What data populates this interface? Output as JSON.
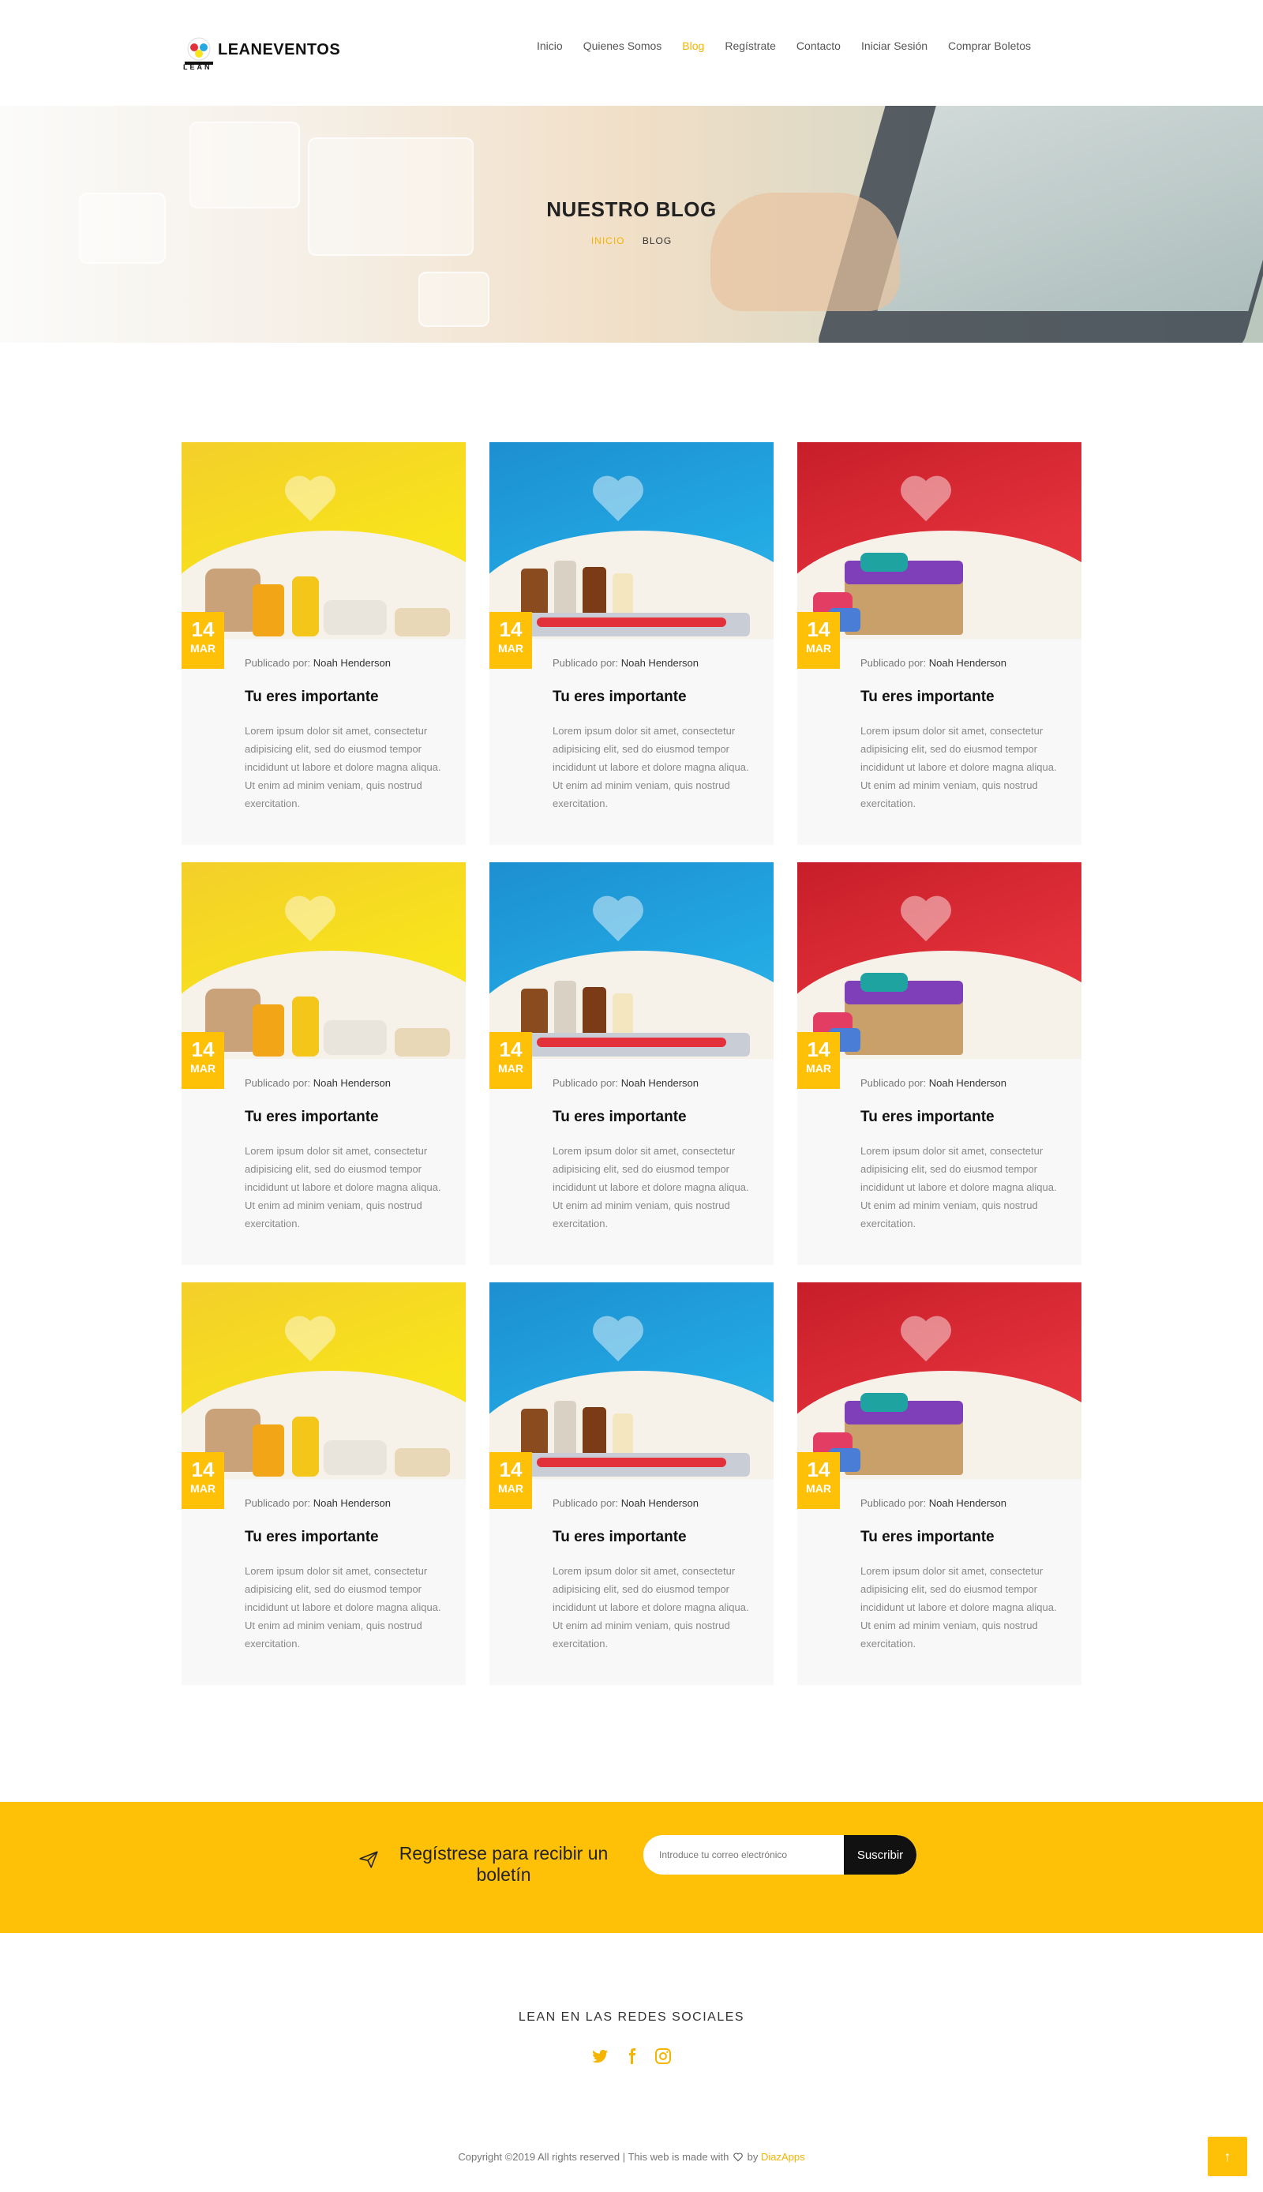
{
  "brand": {
    "name": "LEANEVENTOS",
    "sub": "LEAN"
  },
  "nav": {
    "items": [
      "Inicio",
      "Quienes Somos",
      "Blog",
      "Regístrate",
      "Contacto",
      "Iniciar Sesión",
      "Comprar Boletos"
    ],
    "active": "Blog"
  },
  "hero": {
    "title": "NUESTRO BLOG",
    "crumb_home": "INICIO",
    "crumb_current": "BLOG"
  },
  "posts": [
    {
      "day": "14",
      "month": "MAR",
      "meta_prefix": "Publicado por: ",
      "author": "Noah Henderson",
      "title": "Tu eres importante",
      "body": "Lorem ipsum dolor sit amet, consectetur adipisicing elit, sed do eiusmod tempor incididunt ut labore et dolore magna aliqua. Ut enim ad minim veniam, quis nostrud exercitation.",
      "theme": "yellow"
    },
    {
      "day": "14",
      "month": "MAR",
      "meta_prefix": "Publicado por: ",
      "author": "Noah Henderson",
      "title": "Tu eres importante",
      "body": "Lorem ipsum dolor sit amet, consectetur adipisicing elit, sed do eiusmod tempor incididunt ut labore et dolore magna aliqua. Ut enim ad minim veniam, quis nostrud exercitation.",
      "theme": "blue"
    },
    {
      "day": "14",
      "month": "MAR",
      "meta_prefix": "Publicado por: ",
      "author": "Noah Henderson",
      "title": "Tu eres importante",
      "body": "Lorem ipsum dolor sit amet, consectetur adipisicing elit, sed do eiusmod tempor incididunt ut labore et dolore magna aliqua. Ut enim ad minim veniam, quis nostrud exercitation.",
      "theme": "red"
    },
    {
      "day": "14",
      "month": "MAR",
      "meta_prefix": "Publicado por: ",
      "author": "Noah Henderson",
      "title": "Tu eres importante",
      "body": "Lorem ipsum dolor sit amet, consectetur adipisicing elit, sed do eiusmod tempor incididunt ut labore et dolore magna aliqua. Ut enim ad minim veniam, quis nostrud exercitation.",
      "theme": "yellow"
    },
    {
      "day": "14",
      "month": "MAR",
      "meta_prefix": "Publicado por: ",
      "author": "Noah Henderson",
      "title": "Tu eres importante",
      "body": "Lorem ipsum dolor sit amet, consectetur adipisicing elit, sed do eiusmod tempor incididunt ut labore et dolore magna aliqua. Ut enim ad minim veniam, quis nostrud exercitation.",
      "theme": "blue"
    },
    {
      "day": "14",
      "month": "MAR",
      "meta_prefix": "Publicado por: ",
      "author": "Noah Henderson",
      "title": "Tu eres importante",
      "body": "Lorem ipsum dolor sit amet, consectetur adipisicing elit, sed do eiusmod tempor incididunt ut labore et dolore magna aliqua. Ut enim ad minim veniam, quis nostrud exercitation.",
      "theme": "red"
    },
    {
      "day": "14",
      "month": "MAR",
      "meta_prefix": "Publicado por: ",
      "author": "Noah Henderson",
      "title": "Tu eres importante",
      "body": "Lorem ipsum dolor sit amet, consectetur adipisicing elit, sed do eiusmod tempor incididunt ut labore et dolore magna aliqua. Ut enim ad minim veniam, quis nostrud exercitation.",
      "theme": "yellow"
    },
    {
      "day": "14",
      "month": "MAR",
      "meta_prefix": "Publicado por: ",
      "author": "Noah Henderson",
      "title": "Tu eres importante",
      "body": "Lorem ipsum dolor sit amet, consectetur adipisicing elit, sed do eiusmod tempor incididunt ut labore et dolore magna aliqua. Ut enim ad minim veniam, quis nostrud exercitation.",
      "theme": "blue"
    },
    {
      "day": "14",
      "month": "MAR",
      "meta_prefix": "Publicado por: ",
      "author": "Noah Henderson",
      "title": "Tu eres importante",
      "body": "Lorem ipsum dolor sit amet, consectetur adipisicing elit, sed do eiusmod tempor incididunt ut labore et dolore magna aliqua. Ut enim ad minim veniam, quis nostrud exercitation.",
      "theme": "red"
    }
  ],
  "newsletter": {
    "icon": "paper-plane-icon",
    "text": "Regístrese para recibir un boletín",
    "placeholder": "Introduce tu correo electrónico",
    "button": "Suscribir"
  },
  "social": {
    "title": "LEAN EN LAS REDES SOCIALES",
    "icons": [
      "twitter-icon",
      "facebook-icon",
      "instagram-icon"
    ]
  },
  "footer": {
    "copyright_pre": "Copyright ©2019 All rights reserved | This web is made with",
    "copyright_by": "by",
    "copyright_brand": "DiazApps",
    "to_top": "↑"
  },
  "colors": {
    "accent": "#ffc107",
    "yellow": "#f8e31c",
    "blue": "#22a8e2",
    "red": "#e2313a"
  }
}
